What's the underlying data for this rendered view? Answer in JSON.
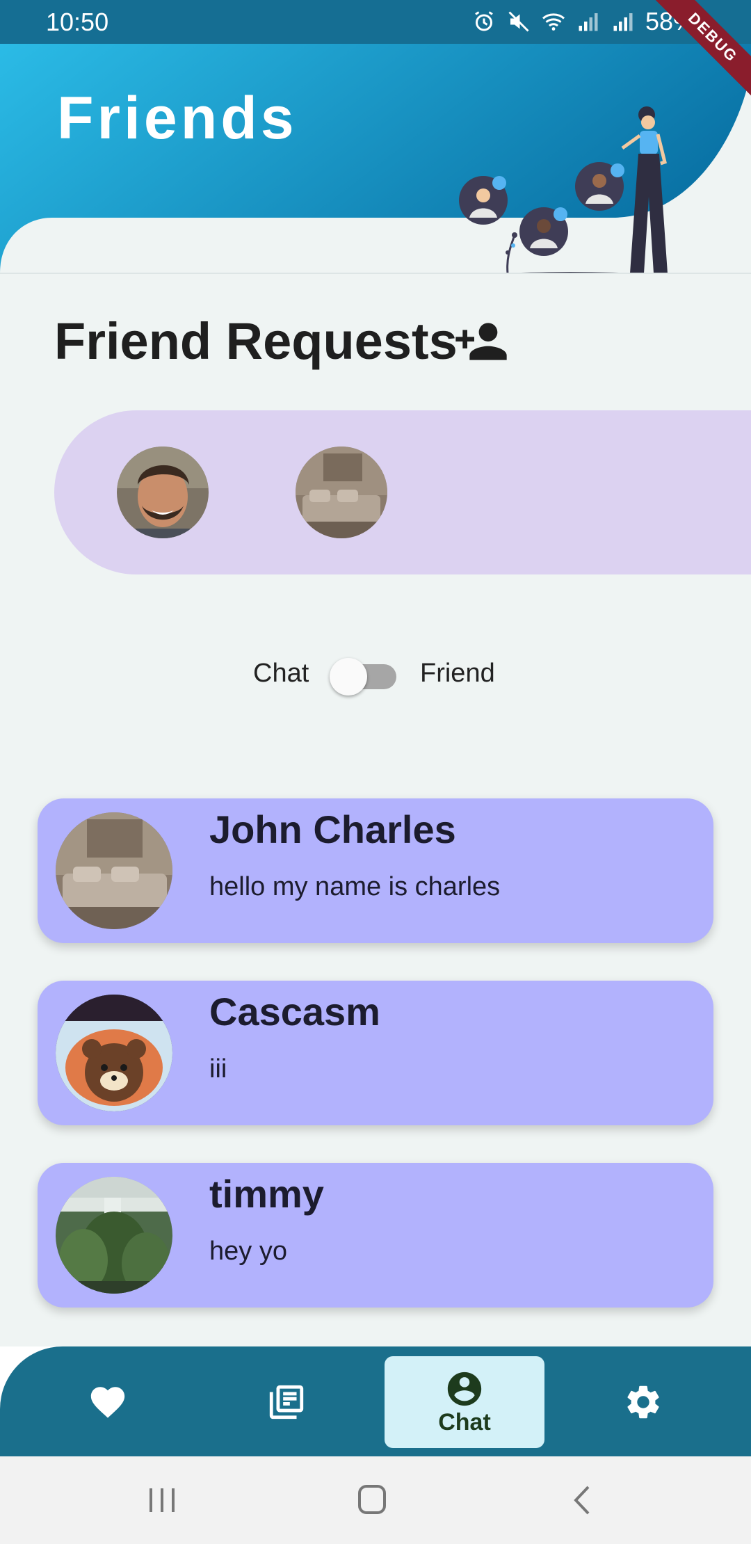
{
  "status_bar": {
    "time": "10:50",
    "battery": "58%",
    "debug_banner": "DEBUG"
  },
  "header": {
    "title": "Friends"
  },
  "friend_requests": {
    "title": "Friend Requests",
    "icon": "person-add-icon",
    "avatars": [
      {
        "name": "request-avatar-man"
      },
      {
        "name": "request-avatar-room"
      }
    ]
  },
  "toggle": {
    "left_label": "Chat",
    "right_label": "Friend",
    "checked": false
  },
  "chats": [
    {
      "name": "John Charles",
      "message": "hello my name is charles",
      "avatar": "room-photo"
    },
    {
      "name": "Cascasm",
      "message": "iii",
      "avatar": "bear-cake-photo"
    },
    {
      "name": "timmy",
      "message": "hey yo",
      "avatar": "tree-photo"
    }
  ],
  "bottom_nav": {
    "items": [
      {
        "icon": "heart-icon",
        "label": ""
      },
      {
        "icon": "feed-icon",
        "label": ""
      },
      {
        "icon": "account-circle-icon",
        "label": "Chat",
        "active": true
      },
      {
        "icon": "gear-icon",
        "label": ""
      }
    ]
  },
  "colors": {
    "status_bar": "#156e93",
    "header_gradient_start": "#2bbbe6",
    "header_gradient_end": "#0a73a6",
    "requests_panel": "#dcd2f1",
    "chat_card": "#b2b2fd",
    "bottom_nav": "#1a6f8c",
    "active_nav": "#d3f1f8"
  }
}
